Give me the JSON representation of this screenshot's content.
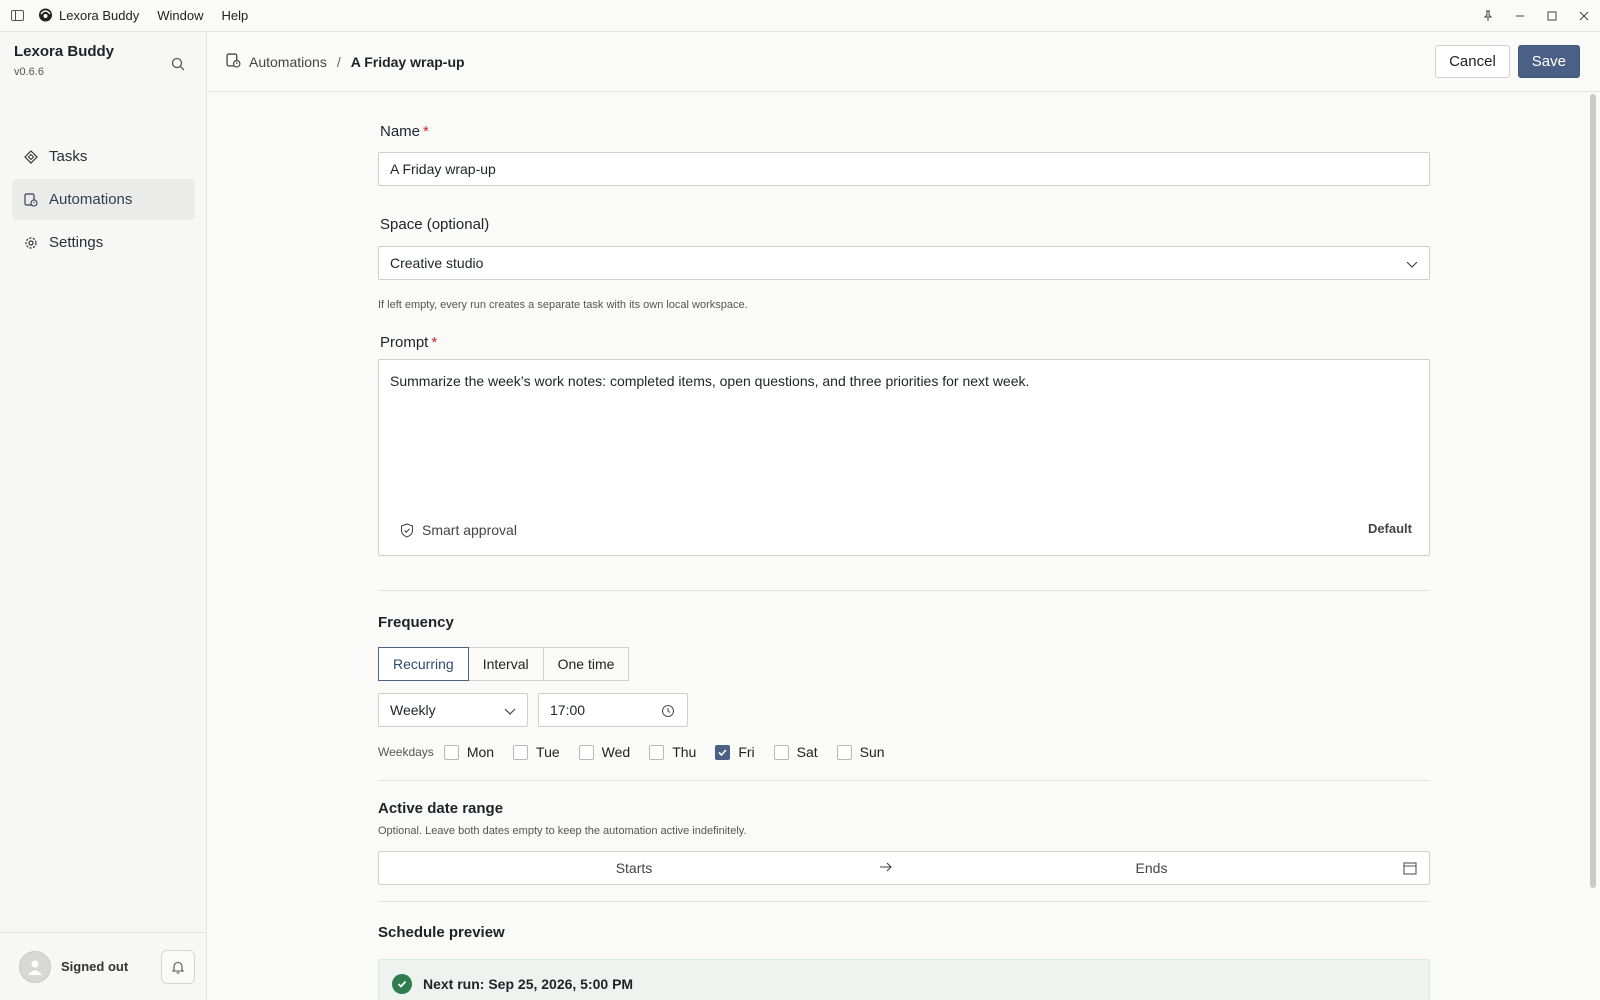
{
  "titlebar": {
    "app_name": "Lexora Buddy",
    "menus": [
      "Window",
      "Help"
    ]
  },
  "sidebar": {
    "brand": "Lexora Buddy",
    "version": "v0.6.6",
    "items": [
      {
        "label": "Tasks",
        "icon": "diamond-icon",
        "active": false
      },
      {
        "label": "Automations",
        "icon": "automation-icon",
        "active": true
      },
      {
        "label": "Settings",
        "icon": "gear-icon",
        "active": false
      }
    ],
    "user_status": "Signed out"
  },
  "header": {
    "breadcrumb_parent": "Automations",
    "breadcrumb_separator": "/",
    "breadcrumb_current": "A Friday wrap-up",
    "cancel_label": "Cancel",
    "save_label": "Save"
  },
  "form": {
    "name_label": "Name",
    "required_mark": "*",
    "name_value": "A Friday wrap-up",
    "space_label": "Space (optional)",
    "space_value": "Creative studio",
    "space_hint": "If left empty, every run creates a separate task with its own local workspace.",
    "prompt_label": "Prompt",
    "prompt_value": "Summarize the week’s work notes: completed items, open questions, and three priorities for next week.",
    "approval_label": "Smart approval",
    "approval_mode": "Default"
  },
  "frequency": {
    "title": "Frequency",
    "modes": [
      "Recurring",
      "Interval",
      "One time"
    ],
    "active_mode": "Recurring",
    "period": "Weekly",
    "time": "17:00",
    "weekdays_label": "Weekdays",
    "days": [
      {
        "label": "Mon",
        "checked": false
      },
      {
        "label": "Tue",
        "checked": false
      },
      {
        "label": "Wed",
        "checked": false
      },
      {
        "label": "Thu",
        "checked": false
      },
      {
        "label": "Fri",
        "checked": true
      },
      {
        "label": "Sat",
        "checked": false
      },
      {
        "label": "Sun",
        "checked": false
      }
    ]
  },
  "date_range": {
    "title": "Active date range",
    "hint": "Optional. Leave both dates empty to keep the automation active indefinitely.",
    "starts_placeholder": "Starts",
    "ends_placeholder": "Ends"
  },
  "schedule_preview": {
    "title": "Schedule preview",
    "next_run": "Next run: Sep 25, 2026, 5:00 PM"
  },
  "colors": {
    "accent": "#4a6185",
    "required": "#c62828",
    "success": "#2f7d4f"
  }
}
